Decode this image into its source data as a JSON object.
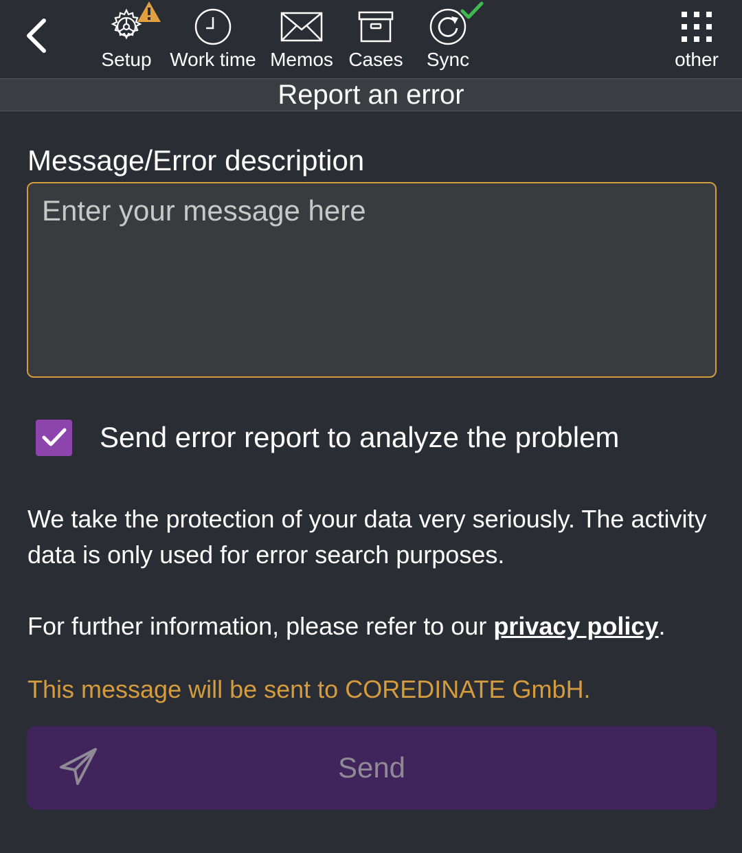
{
  "header": {
    "nav": [
      {
        "id": "setup",
        "label": "Setup",
        "icon": "gear-icon",
        "badge": "warning-icon"
      },
      {
        "id": "worktime",
        "label": "Work time",
        "icon": "clock-icon"
      },
      {
        "id": "memos",
        "label": "Memos",
        "icon": "envelope-icon"
      },
      {
        "id": "cases",
        "label": "Cases",
        "icon": "archive-box-icon"
      },
      {
        "id": "sync",
        "label": "Sync",
        "icon": "refresh-icon",
        "badge": "checkmark-icon"
      },
      {
        "id": "other",
        "label": "other",
        "icon": "grid-icon"
      }
    ]
  },
  "page": {
    "title": "Report an error"
  },
  "form": {
    "message_label": "Message/Error description",
    "message_placeholder": "Enter your message here",
    "message_value": "",
    "checkbox_label": "Send error report to analyze the problem",
    "checkbox_checked": true,
    "info_text": "We take the protection of your data very seriously. The activity data is only used for error search purposes.",
    "policy_prefix": "For further information, please refer to our ",
    "policy_link": "privacy policy",
    "policy_suffix": ".",
    "recipient_text": "This message will be sent to COREDINATE GmbH.",
    "send_label": "Send"
  },
  "colors": {
    "background": "#2a2d34",
    "accent_orange": "#d49c3d",
    "accent_purple": "#8e44ad",
    "send_button": "#41245c",
    "sync_ok": "#3fb950",
    "warning": "#e0a040"
  }
}
